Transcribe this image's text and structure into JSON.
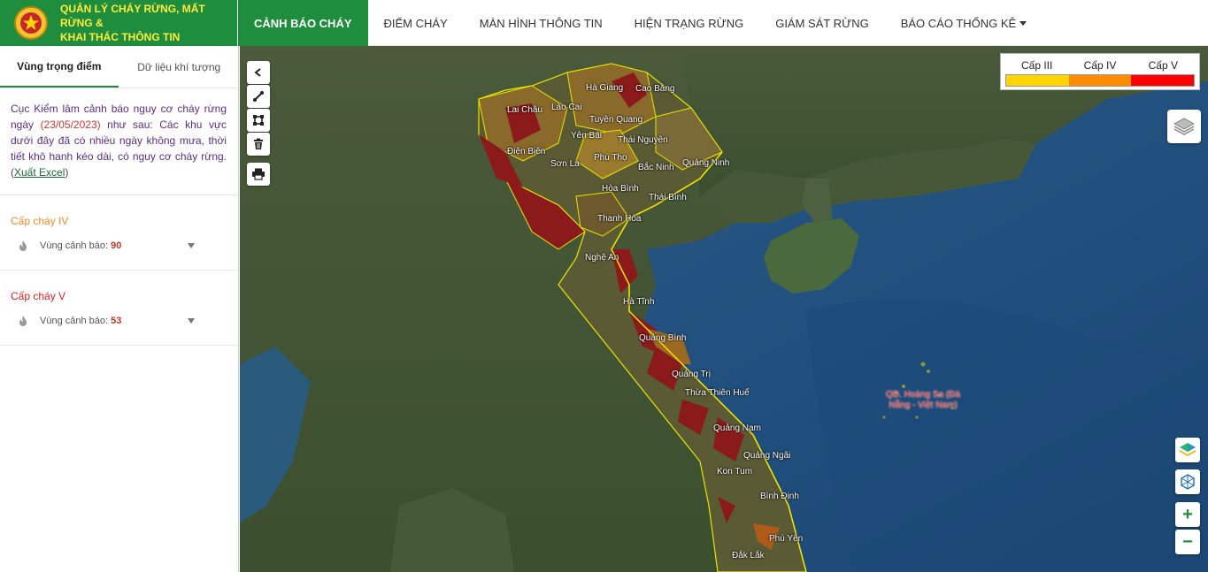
{
  "header": {
    "brand_line1": "QUẢN LÝ CHÁY RỪNG, MẤT RỪNG &",
    "brand_line2": "KHAI THÁC THÔNG TIN",
    "nav": [
      {
        "label": "CẢNH BÁO CHÁY",
        "active": true
      },
      {
        "label": "ĐIỂM CHÁY",
        "active": false
      },
      {
        "label": "MÀN HÌNH THÔNG TIN",
        "active": false
      },
      {
        "label": "HIỆN TRẠNG RỪNG",
        "active": false
      },
      {
        "label": "GIÁM SÁT RỪNG",
        "active": false
      },
      {
        "label": "BÁO CÁO THỐNG KÊ",
        "active": false,
        "has_dropdown": true
      }
    ]
  },
  "sidebar": {
    "tabs": [
      {
        "label": "Vùng trọng điểm",
        "active": true
      },
      {
        "label": "Dữ liệu khí tượng",
        "active": false
      }
    ],
    "notice": {
      "prefix": "Cục Kiểm lâm cảnh báo nguy cơ cháy rừng ngày",
      "date": "(23/05/2023)",
      "body": "như sau: Các khu vực dưới đây đã có nhiều ngày không mưa, thời tiết khô hanh kéo dài, có nguy cơ cháy rừng.(",
      "link": "Xuất Excel",
      "suffix": ")"
    },
    "levels": [
      {
        "title": "Cấp cháy IV",
        "label": "Vùng cảnh báo:",
        "count": "90",
        "color": "#f28c28"
      },
      {
        "title": "Cấp cháy V",
        "label": "Vùng cảnh báo:",
        "count": "53",
        "color": "#e02020"
      }
    ]
  },
  "map": {
    "legend": [
      {
        "label": "Cấp III",
        "color": "#ffd500"
      },
      {
        "label": "Cấp IV",
        "color": "#ff8c00"
      },
      {
        "label": "Cấp V",
        "color": "#ff0000"
      }
    ],
    "island_label": "QĐ. Hoàng Sa (Đà Nẵng - Việt Nam)",
    "place_labels": [
      "Hà Giang",
      "Cao Bằng",
      "Lai Châu",
      "Lào Cai",
      "Tuyên Quang",
      "Yên Bái",
      "Thái Nguyên",
      "Điện Biên",
      "Sơn La",
      "Phú Thọ",
      "Bắc Ninh",
      "Quảng Ninh",
      "Hòa Bình",
      "Thái Bình",
      "Thanh Hóa",
      "Nghệ An",
      "Hà Tĩnh",
      "Quảng Bình",
      "Quảng Trị",
      "Thừa Thiên Huế",
      "Quảng Nam",
      "Quảng Ngãi",
      "Kon Tum",
      "Bình Định",
      "Phú Yên",
      "Đắk Lắk"
    ],
    "tools": [
      "collapse-icon",
      "line-measure-icon",
      "area-measure-icon",
      "trash-icon",
      "print-icon"
    ],
    "zoom_in": "+",
    "zoom_out": "−"
  }
}
